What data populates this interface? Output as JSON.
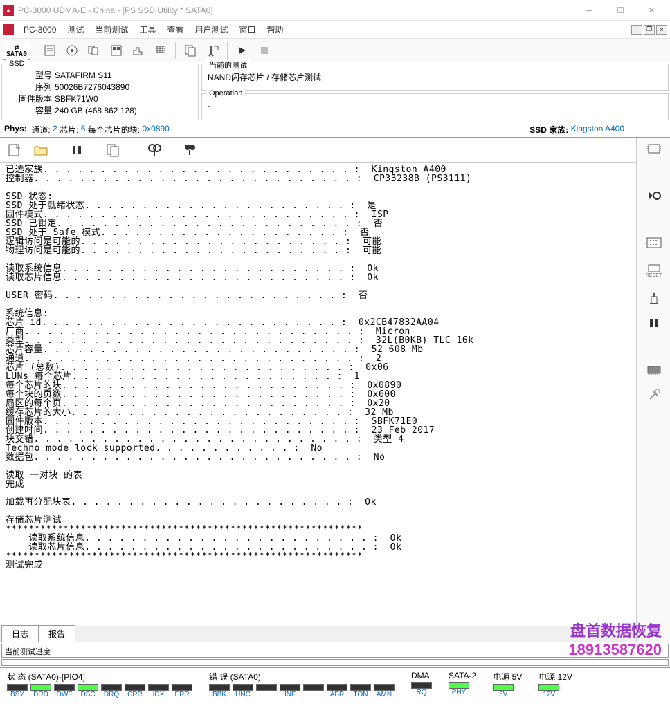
{
  "window": {
    "title": "PC-3000 UDMA-E - China - [PS SSD Utility * SATA0]"
  },
  "menu": {
    "app": "PC-3000",
    "items": [
      "测试",
      "当前测试",
      "工具",
      "查看",
      "用户测试",
      "窗口",
      "帮助"
    ]
  },
  "sata_label": "SATA0",
  "ssd_box": {
    "title": "SSD",
    "model_label": "型号",
    "model": "SATAFIRM   S11",
    "serial_label": "序列",
    "serial": "50026B7276043890",
    "fw_label": "固件版本",
    "fw": "SBFK71W0",
    "capacity_label": "容量",
    "capacity": "240 GB (468 862 128)"
  },
  "test_box": {
    "title": "当前的测试",
    "value": "NAND闪存芯片 / 存储芯片测试"
  },
  "op_box": {
    "title": "Operation",
    "value": "-"
  },
  "phys": {
    "label": "Phys:",
    "channel_k": "通道:",
    "channel_v": "2",
    "chip_k": "芯片:",
    "chip_v": "6",
    "blocks_k": "每个芯片的块:",
    "blocks_v": "0x0890",
    "ssd_family_k": "SSD 家族:",
    "ssd_family_v": "Kingston A400"
  },
  "log_lines": [
    "已选家族. . . . . . . . . . . . . . . . . . . . . . . . . . . :  Kingston A400",
    "控制器. . . . . . . . . . . . . . . . . . . . . . . . . . . . :  CP33238B (PS3111)",
    "",
    "SSD 状态:",
    "SSD 处于就绪状态. . . . . . . . . . . . . . . . . . . . . . . :  是",
    "固件模式. . . . . . . . . . . . . . . . . . . . . . . . . . . :  ISP",
    "SSD 已锁定. . . . . . . . . . . . . . . . . . . . . . . . . . :  否",
    "SSD 处于 Safe 模式. . . . . . . . . . . . . . . . . . . . . :  否",
    "逻辑访问是可能的. . . . . . . . . . . . . . . . . . . . . . . :  可能",
    "物理访问是可能的. . . . . . . . . . . . . . . . . . . . . . . :  可能",
    "",
    "读取系统信息. . . . . . . . . . . . . . . . . . . . . . . . . :  Ok",
    "读取芯片信息. . . . . . . . . . . . . . . . . . . . . . . . . :  Ok",
    "",
    "USER 密码. . . . . . . . . . . . . . . . . . . . . . . . . :  否",
    "",
    "系统信息:",
    "芯片 id. . . . . . . . . . . . . . . . . . . . . . . . . . :  0x2CB47832AA04",
    "厂商. . . . . . . . . . . . . . . . . . . . . . . . . . . . . :  Micron",
    "类型. . . . . . . . . . . . . . . . . . . . . . . . . . . . . :  32L(B0KB) TLC 16k",
    "芯片容量. . . . . . . . . . . . . . . . . . . . . . . . . . . :  52 608 Mb",
    "通道. . . . . . . . . . . . . . . . . . . . . . . . . . . . . :  2",
    "芯片 (总数). . . . . . . . . . . . . . . . . . . . . . . . . :  0x06",
    "LUNs 每个芯片. . . . . . . . . . . . . . . . . . . . . . . :  1",
    "每个芯片的块. . . . . . . . . . . . . . . . . . . . . . . . . :  0x0890",
    "每个块的页数. . . . . . . . . . . . . . . . . . . . . . . . . :  0x600",
    "扇区的每个页. . . . . . . . . . . . . . . . . . . . . . . . . :  0x20",
    "缓存芯片的大小. . . . . . . . . . . . . . . . . . . . . . . . :  32 Mb",
    "固件版本. . . . . . . . . . . . . . . . . . . . . . . . . . . :  SBFK71E0",
    "创建时间. . . . . . . . . . . . . . . . . . . . . . . . . . . :  23 Feb 2017",
    "块交错. . . . . . . . . . . . . . . . . . . . . . . . . . . . :  类型 4",
    "Techno mode lock supported. . . . . . . . . . . . :  No",
    "数据包. . . . . . . . . . . . . . . . . . . . . . . . . . . . :  No",
    "",
    "读取 一对块 的表",
    "完成",
    "",
    "加载再分配块表. . . . . . . . . . . . . . . . . . . . . . . . :  Ok",
    "",
    "存储芯片测试",
    "**************************************************************",
    "    读取系统信息. . . . . . . . . . . . . . . . . . . . . . . . . :  Ok",
    "    读取芯片信息. . . . . . . . . . . . . . . . . . . . . . . . . :  Ok",
    "**************************************************************",
    "测试完成"
  ],
  "tabs": {
    "log": "日志",
    "report": "报告"
  },
  "progress_label": "当前测试进度",
  "status": {
    "state_label": "状 态 (SATA0)-[PIO4]",
    "state_items": [
      "BSY",
      "DRD",
      "DWF",
      "DSC",
      "DRQ",
      "CRR",
      "IDX",
      "ERR"
    ],
    "state_on": [
      false,
      true,
      false,
      true,
      false,
      false,
      false,
      false
    ],
    "err_label": "错 误 (SATA0)",
    "err_items": [
      "BBK",
      "UNC",
      "",
      "INF",
      "",
      "ABR",
      "TON",
      "AMN"
    ],
    "dma_label": "DMA",
    "dma_item": "RQ",
    "sata2_label": "SATA-2",
    "sata2_item": "PHY",
    "p5_label": "电源 5V",
    "p5_item": "5V",
    "p12_label": "电源 12V",
    "p12_item": "12V"
  },
  "watermark": {
    "line1": "盘首数据恢复",
    "line2": "18913587620"
  },
  "reset_label": "RESET"
}
